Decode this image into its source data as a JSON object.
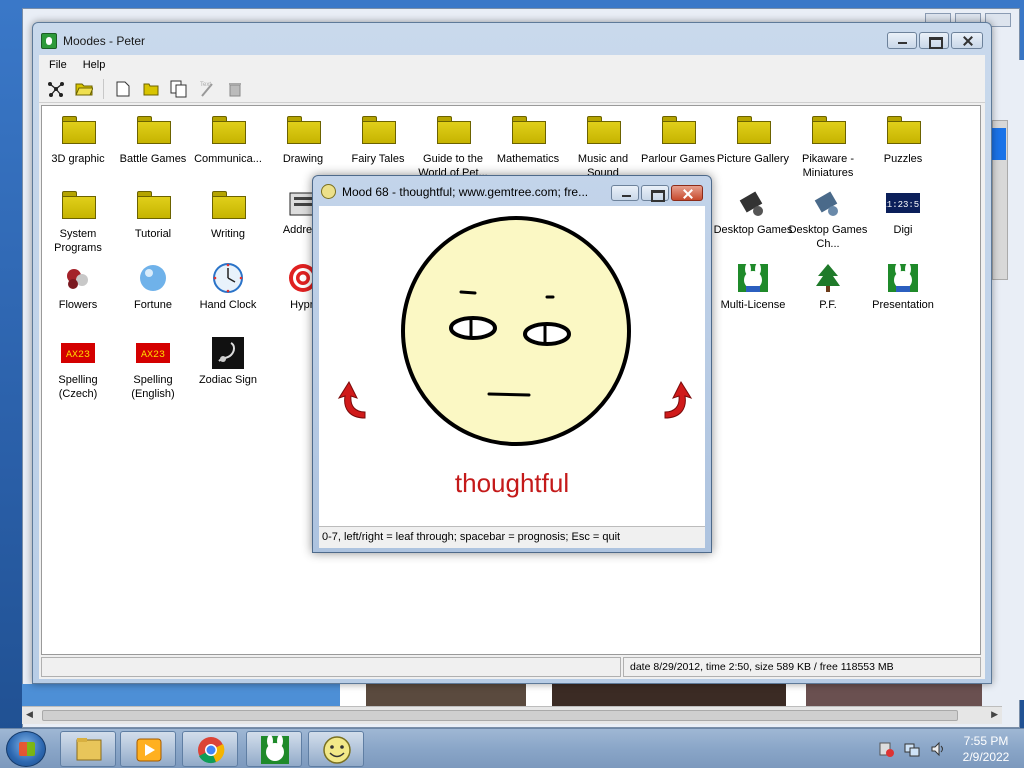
{
  "main_window": {
    "title": "Moodes - Peter",
    "menu": [
      "File",
      "Help"
    ],
    "toolbar_icons": [
      "network-icon",
      "open-folder-icon",
      "new-document-icon",
      "folder-icon",
      "copy-icon",
      "text-tool-icon",
      "trash-icon"
    ],
    "items": [
      {
        "label": "3D graphic",
        "icon": "folder-icon"
      },
      {
        "label": "Battle Games",
        "icon": "folder-icon"
      },
      {
        "label": "Communica...",
        "icon": "folder-icon"
      },
      {
        "label": "Drawing",
        "icon": "folder-icon"
      },
      {
        "label": "Fairy Tales",
        "icon": "folder-icon"
      },
      {
        "label": "Guide to the World of Pet...",
        "icon": "folder-icon"
      },
      {
        "label": "Mathematics",
        "icon": "folder-icon"
      },
      {
        "label": "Music and Sound",
        "icon": "folder-icon"
      },
      {
        "label": "Parlour Games",
        "icon": "folder-icon"
      },
      {
        "label": "Picture Gallery",
        "icon": "folder-icon"
      },
      {
        "label": "Pikaware - Miniatures",
        "icon": "folder-icon"
      },
      {
        "label": "Puzzles",
        "icon": "folder-icon"
      },
      {
        "label": "System Programs",
        "icon": "folder-icon"
      },
      {
        "label": "Tutorial",
        "icon": "folder-icon"
      },
      {
        "label": "Writing",
        "icon": "folder-icon"
      },
      {
        "label": "Address",
        "icon": "address-book-icon"
      },
      {
        "label": "Desktop Games",
        "icon": "desktop-games-icon"
      },
      {
        "label": "Desktop Games Ch...",
        "icon": "desktop-games-check-icon"
      },
      {
        "label": "Digi",
        "icon": "digital-clock-icon",
        "display": "11:23:51"
      },
      {
        "label": "Flowers",
        "icon": "flowers-icon"
      },
      {
        "label": "Fortune",
        "icon": "crystal-ball-icon"
      },
      {
        "label": "Hand Clock",
        "icon": "analog-clock-icon"
      },
      {
        "label": "Hypn",
        "icon": "hypnosis-spiral-icon"
      },
      {
        "label": "Multi-License",
        "icon": "bunny-icon"
      },
      {
        "label": "P.F.",
        "icon": "christmas-tree-icon"
      },
      {
        "label": "Presentation",
        "icon": "bunny-icon"
      },
      {
        "label": "Spelling (Czech)",
        "icon": "spelling-icon",
        "display": "AX23"
      },
      {
        "label": "Spelling (English)",
        "icon": "spelling-icon",
        "display": "AX23"
      },
      {
        "label": "Zodiac Sign",
        "icon": "scorpion-icon"
      }
    ],
    "status": "date 8/29/2012, time 2:50, size 589 KB / free 118553 MB"
  },
  "mood_window": {
    "title": "Mood 68 - thoughtful;  www.gemtree.com;  fre...",
    "mood_label": "thoughtful",
    "status": "0-7, left/right = leaf through;    spacebar = prognosis;    Esc = quit"
  },
  "taskbar": {
    "time": "7:55 PM",
    "date": "2/9/2022",
    "pinned": [
      "explorer-icon",
      "media-player-icon",
      "chrome-icon",
      "bunny-app-icon",
      "smiley-app-icon"
    ]
  },
  "colors": {
    "folder": "#d4c200",
    "mood_text": "#c41a1a",
    "face": "#fbf8c4"
  }
}
